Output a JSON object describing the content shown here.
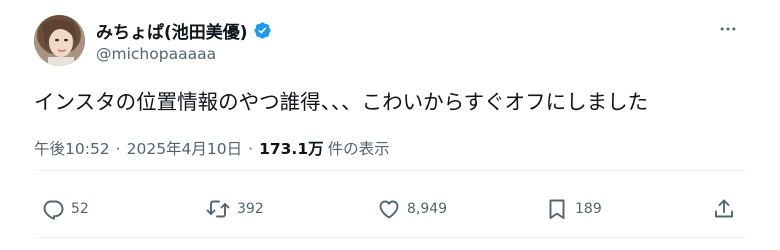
{
  "user": {
    "display_name": "みちょぱ(池田美優)",
    "handle": "@michopaaaaa",
    "verified": true
  },
  "tweet": {
    "text": "インスタの位置情報のやつ誰得、、、こわいからすぐオフにしました",
    "time": "午後10:52",
    "separator": "·",
    "date": "2025年4月10日",
    "views_count": "173.1万",
    "views_label": "件の表示"
  },
  "actions": {
    "reply": {
      "icon": "reply-icon",
      "count": "52"
    },
    "retweet": {
      "icon": "retweet-icon",
      "count": "392"
    },
    "like": {
      "icon": "heart-icon",
      "count": "8,949"
    },
    "bookmark": {
      "icon": "bookmark-icon",
      "count": "189"
    },
    "share": {
      "icon": "share-icon"
    }
  },
  "colors": {
    "text_primary": "#0f1419",
    "text_secondary": "#536471",
    "verified_badge": "#1d9bf0",
    "divider": "#eff3f4"
  }
}
